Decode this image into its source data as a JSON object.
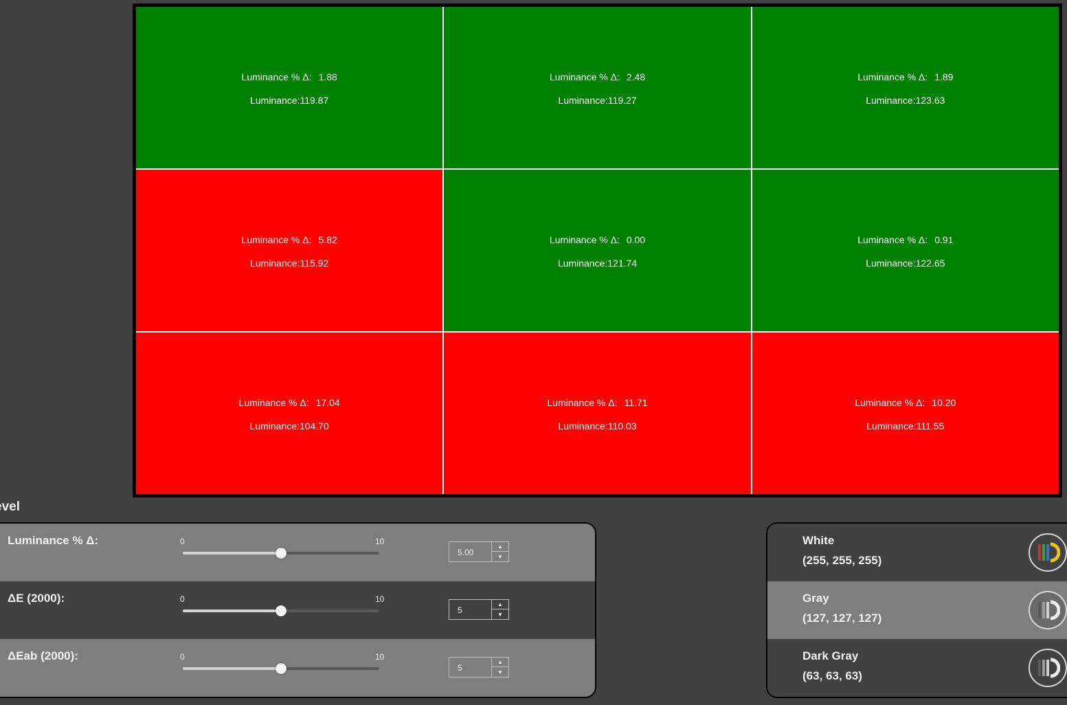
{
  "grid": {
    "pass_color": "#008000",
    "fail_color": "#ff0000",
    "delta_label": "Luminance % Δ:",
    "luminance_label": "Luminance:",
    "cells": [
      {
        "status": "pass",
        "delta": "1.88",
        "luminance": "119.87"
      },
      {
        "status": "pass",
        "delta": "2.48",
        "luminance": "119.27"
      },
      {
        "status": "pass",
        "delta": "1.89",
        "luminance": "123.63"
      },
      {
        "status": "fail",
        "delta": "5.82",
        "luminance": "115.92"
      },
      {
        "status": "pass",
        "delta": "0.00",
        "luminance": "121.74"
      },
      {
        "status": "pass",
        "delta": "0.91",
        "luminance": "122.65"
      },
      {
        "status": "fail",
        "delta": "17.04",
        "luminance": "104.70"
      },
      {
        "status": "fail",
        "delta": "11.71",
        "luminance": "110.03"
      },
      {
        "status": "fail",
        "delta": "10.20",
        "luminance": "111.55"
      }
    ]
  },
  "section": {
    "title_visible": "evel"
  },
  "thresholds": [
    {
      "label": "Luminance % Δ:",
      "min": "0",
      "max": "10",
      "value": 5,
      "display": "5.00"
    },
    {
      "label": "ΔE (2000):",
      "min": "0",
      "max": "10",
      "value": 5,
      "display": "5"
    },
    {
      "label": "ΔEab (2000):",
      "min": "0",
      "max": "10",
      "value": 5,
      "display": "5"
    }
  ],
  "patterns": [
    {
      "name": "White",
      "rgb": "(255, 255, 255)",
      "icon": "rgb-pattern-icon"
    },
    {
      "name": "Gray",
      "rgb": "(127, 127, 127)",
      "icon": "gray-pattern-icon"
    },
    {
      "name": "Dark Gray",
      "rgb": "(63, 63, 63)",
      "icon": "gray-pattern-icon"
    }
  ]
}
